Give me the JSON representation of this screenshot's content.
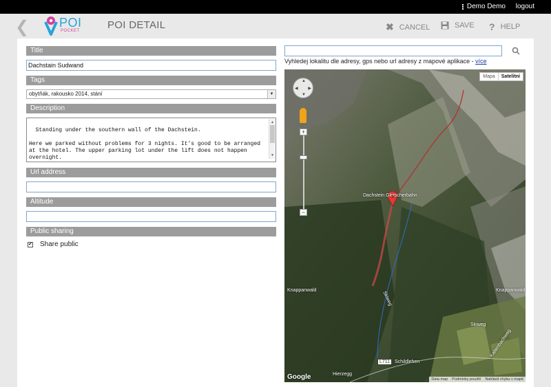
{
  "topbar": {
    "user": "Demo Demo",
    "logout": "logout"
  },
  "header": {
    "title": "POI DETAIL",
    "logo_main": "POI",
    "logo_sub": "POCKET",
    "cancel": "CANCEL",
    "save": "SAVE",
    "help": "HELP"
  },
  "form": {
    "title_label": "Title",
    "title_value": "Dachstain Sudwand",
    "tags_label": "Tags",
    "tags_value": "obytňák, rakousko 2014, stání",
    "description_label": "Description",
    "description_value": "Standing under the southern wall of the Dachstein.\n\nHere we parked without problems for 3 nights. It's good to be arranged at the hotel. The upper parking lot under the lift does not happen overnight.",
    "url_label": "Url address",
    "url_value": "",
    "altitude_label": "Altitude",
    "altitude_value": "",
    "sharing_label": "Public sharing",
    "share_public_label": "Share public",
    "share_public_checked": true
  },
  "map": {
    "search_value": "",
    "hint_text": "Vyhledej lokalitu dle adresy, gps nebo url adresy z mapové aplikace - ",
    "hint_link": "více",
    "type_map": "Mapa",
    "type_satellite": "Satelitní",
    "labels": {
      "dachstein": "Dachstein Gletscherbahn",
      "knappanwald_left": "Knappanwald",
      "knappanwald_right": "Knappanwald",
      "skiweg_left": "Skiweg",
      "skiweg_right": "Skiweg",
      "l711": "L711",
      "schildlehen": "Schildlehen",
      "hierzegg": "Hierzegg",
      "kaltenbach": "Kaltenbachweg"
    },
    "attribution": [
      "Data map",
      "Podmínky použití",
      "Nahlásit chybu v mapě"
    ],
    "logo": "Google"
  }
}
